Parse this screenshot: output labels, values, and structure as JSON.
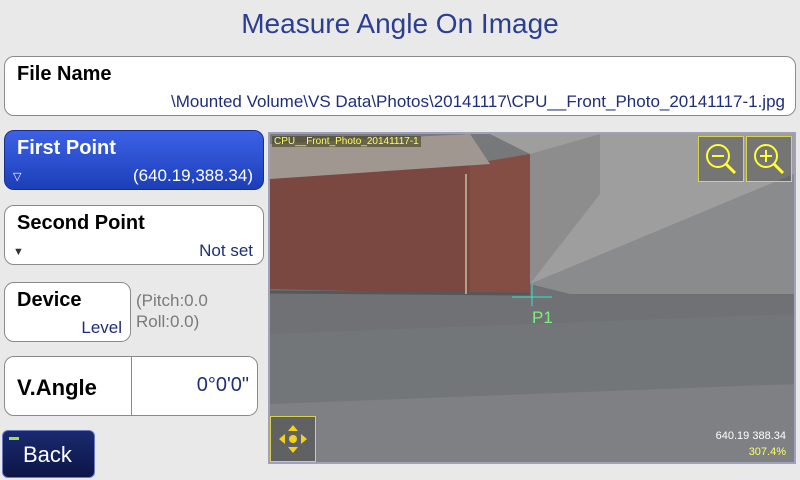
{
  "title": "Measure Angle On Image",
  "file": {
    "label": "File Name",
    "path": "\\Mounted Volume\\VS Data\\Photos\\20141117\\CPU__Front_Photo_20141117-1.jpg"
  },
  "first_point": {
    "label": "First Point",
    "value": "(640.19,388.34)",
    "arrow": "▽"
  },
  "second_point": {
    "label": "Second Point",
    "value": "Not set",
    "arrow": "▼"
  },
  "device": {
    "label": "Device",
    "value": "Level",
    "pitch": "(Pitch:0.0",
    "roll": "Roll:0.0)"
  },
  "vangle": {
    "label": "V.Angle",
    "value": "0°0'0\""
  },
  "back_label": "Back",
  "image": {
    "name": "CPU__Front_Photo_20141117-1",
    "marker_label": "P1",
    "coord_readout": "640.19 388.34",
    "zoom_level": "307.4%"
  },
  "icons": {
    "zoom_out": "zoom-out-icon",
    "zoom_in": "zoom-in-icon",
    "pan": "pan-arrows-icon"
  },
  "colors": {
    "title": "#2a3f8f",
    "selected_button": "#2e52d8",
    "value_text": "#1e2e78",
    "crosshair": "#40e0d0",
    "marker_label": "#7ef07e",
    "overlay_yellow": "#ffff66"
  }
}
